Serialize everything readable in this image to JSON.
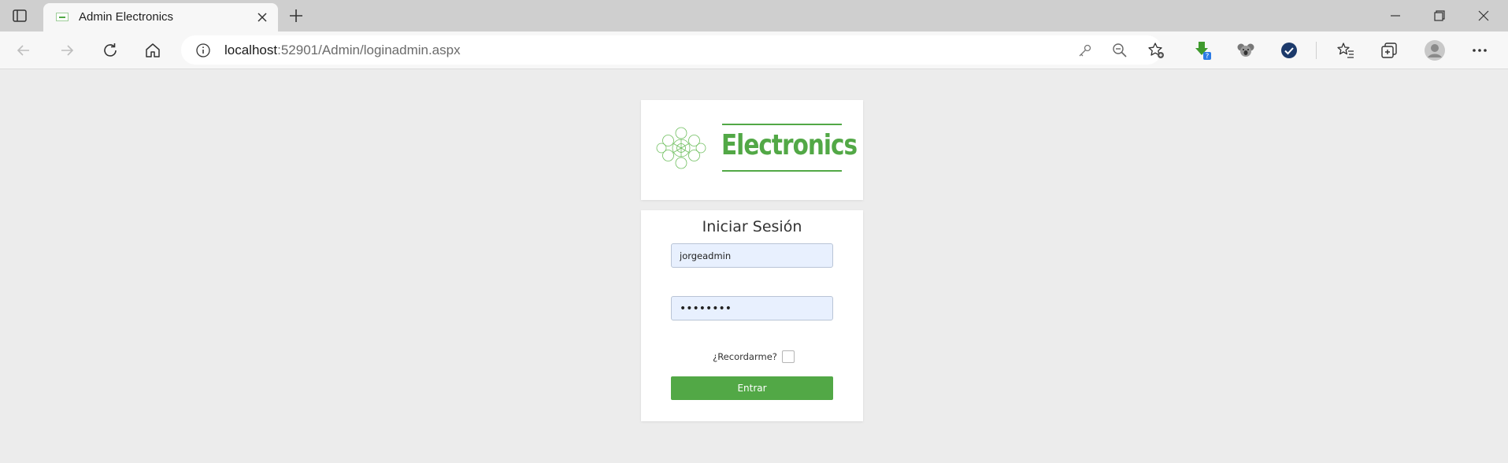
{
  "browser": {
    "tab_title": "Admin Electronics",
    "url_host": "localhost",
    "url_rest": ":52901/Admin/loginadmin.aspx",
    "extension_badge": "?"
  },
  "brand": {
    "name": "Electronics",
    "accent_color": "#52a846"
  },
  "login": {
    "title": "Iniciar Sesión",
    "username_value": "jorgeadmin",
    "password_masked": "••••••••",
    "remember_label": "¿Recordarme?",
    "remember_checked": false,
    "submit_label": "Entrar"
  },
  "icons": {
    "tab_toggle": "tab-actions-icon",
    "close": "close-icon",
    "new_tab": "plus-icon",
    "back": "back-arrow-icon",
    "forward": "forward-arrow-icon",
    "refresh": "refresh-icon",
    "home": "home-icon",
    "info": "info-icon",
    "key": "key-icon",
    "zoom_out": "zoom-out-icon",
    "add_favorite": "add-favorite-icon",
    "favorites": "favorites-icon",
    "collections": "collections-icon",
    "profile": "profile-icon",
    "more": "more-icon"
  }
}
